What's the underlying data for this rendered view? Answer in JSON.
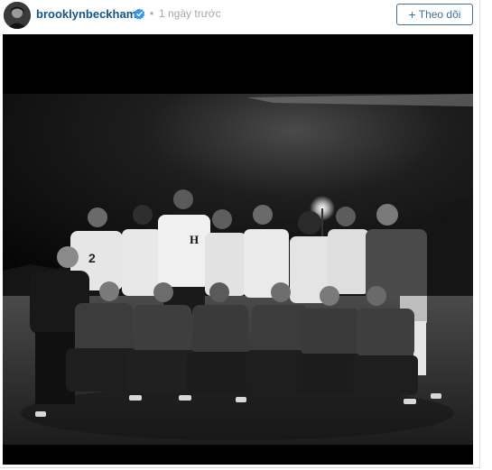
{
  "post": {
    "username": "brooklynbeckham",
    "verified": true,
    "time_separator": "•",
    "timestamp": "1 ngày trước",
    "follow_button": {
      "icon": "plus-icon",
      "label": "Theo dõi"
    }
  },
  "photo": {
    "style": "black-and-white",
    "subject": "team-group-photo-on-field-at-night",
    "jersey_number": "2",
    "shirt_letter": "H"
  },
  "colors": {
    "username": "#125688",
    "follow_accent": "#3f729b",
    "verified_badge": "#3897f0",
    "timestamp": "#a5a7aa"
  }
}
